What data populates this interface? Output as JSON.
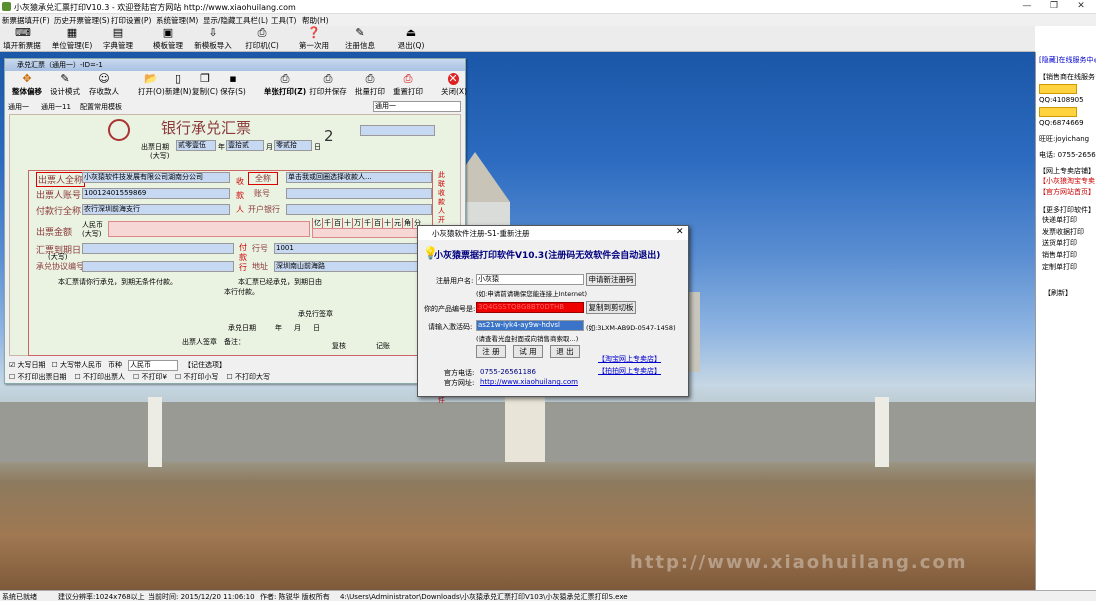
{
  "window": {
    "title": "小灰猿承兑汇票打印V10.3 - 欢迎登陆官方网站 http://www.xiaohuilang.com",
    "min": "—",
    "max": "❐",
    "close": "✕"
  },
  "menu": [
    "新票据填开(F)",
    "历史开票管理(S)",
    "打印设置(P)",
    "系统管理(M)",
    "显示/隐藏工具栏(L)",
    "工具(T)",
    "帮助(H)"
  ],
  "toolbar": [
    "填开新票据",
    "单位管理(E)",
    "字典管理",
    "模板管理",
    "新模板导入",
    "打印机(C)",
    "第一次用",
    "注册信息",
    "退出(Q)"
  ],
  "bill_window": {
    "title": "承兑汇票（通用一）-ID=-1",
    "tools": [
      "整体偏移",
      "设计模式",
      "存收款人",
      "打开(O)",
      "新建(N)",
      "复制(C)",
      "保存(S)",
      "单张打印(Z)",
      "打印并保存",
      "批量打印",
      "重置打印",
      "关闭(X)"
    ],
    "tabs": [
      "通用一",
      "通用一11",
      "配置常用模板"
    ],
    "template_select": "通用一",
    "bank_title": "银行承兑汇票",
    "copy_no": "2",
    "issue_label": "出票日期",
    "issue_label2": "(大写)",
    "year_val": "贰零壹伍",
    "month_val": "壹拾贰",
    "day_val": "零贰拾",
    "year_unit": "年",
    "month_unit": "月",
    "day_unit": "日",
    "drawer_name_label": "出票人全称",
    "drawer_name": "小灰猿软件技发展有限公司湖南分公司",
    "drawer_acct_label": "出票人账号",
    "drawer_acct": "10012401559869",
    "pay_bank_label": "付款行全称",
    "pay_bank": "农行深圳前海支行",
    "amount_label": "出票金额",
    "amount_rmb": "人民币",
    "amount_rmb2": "(大写)",
    "payee_full_label": "全称",
    "payee_full_placeholder": "单击我或回圈选择收款人...",
    "payee_acct_label": "账号",
    "payee_bank_label": "开户银行",
    "payee_side": [
      "收",
      "款",
      "人"
    ],
    "digits": [
      "亿",
      "千",
      "百",
      "十",
      "万",
      "千",
      "百",
      "十",
      "元",
      "角",
      "分"
    ],
    "due_label": "汇票到期日",
    "due_label2": "(大写)",
    "agreement_label": "承兑协议编号",
    "bank_side": "付款行",
    "bank_no_label": "行号",
    "bank_no": "1001",
    "bank_addr_label": "地址",
    "bank_addr": "深圳南山前海路",
    "note1": "本汇票请你行承兑，到期无条件付款。",
    "note2a": "本汇票已经承兑，到期日由",
    "note2b": "本行付款。",
    "accept_label": "承兑行签章",
    "accept_date": "承兑日期",
    "remark": "备注：",
    "drawer_sign": "出票人签章",
    "review": "复核",
    "record": "记账",
    "options": [
      "大写日期",
      "大写带人民币",
      "币种",
      "人民币",
      "【记住选项】"
    ],
    "options2": [
      "不打印出票日期",
      "不打印出票人",
      "不打印¥",
      "不打印小写",
      "不打印大写"
    ],
    "side_vertical": "此联收款人开户行随委托收款凭证寄付款行作借方凭证附件"
  },
  "dialog": {
    "title": "小灰猿软件注册-S1-重新注册",
    "heading": "小灰猿票据打印软件V10.3(注册码无效软件会自动退出)",
    "user_label": "注册用户名:",
    "user_value": "小灰猿",
    "reg_btn": "申请新注册码",
    "user_hint": "(如:申请前请确保您能连接上Internet)",
    "product_label": "你的产品编号是:",
    "product_value": "3Q4GSSTQ8G8BT0DTHB",
    "copy_btn": "复制到剪切板",
    "code_label": "请输入激活码:",
    "code_value": "as21w-iyk4-ay9w-hdvsl",
    "code_hint": "(如:3LXM-AB9D-0547-1458)",
    "code_hint2": "(请查看光盘封面或向销售商索取...)",
    "buttons": [
      "注 册",
      "试 用",
      "退 出"
    ],
    "shop1": "【淘宝网上专卖店】",
    "shop2": "【拍拍网上专卖店】",
    "phone_label": "官方电话:",
    "phone": "0755-26561186",
    "site_label": "官方网址:",
    "site": "http://www.xiaohuilang.com"
  },
  "side": [
    "[隐藏]在线服务中心",
    "【销售商在线服务",
    "QQ:4108905",
    "QQ:6874669",
    "旺旺:joyichang",
    "电话: 0755-2656",
    "【网上专卖店铺】",
    "【小灰狼淘宝专卖",
    "【官方网站首页】",
    "【更多打印软件】",
    "快递单打印",
    "发票收据打印",
    "送货单打印",
    "销售单打印",
    "定制单打印",
    "【刷新】"
  ],
  "watermark": "http://www.xiaohuilang.com",
  "status": [
    "系统已就绪",
    "建议分辨率:1024x768以上",
    "当前时间: 2015/12/20 11:06:10",
    "作者: 陈锐华 版权所有",
    "4:\\Users\\Administrator\\Downloads\\小灰猿承兑汇票打印V103\\小灰猿承兑汇票打印S.exe"
  ]
}
